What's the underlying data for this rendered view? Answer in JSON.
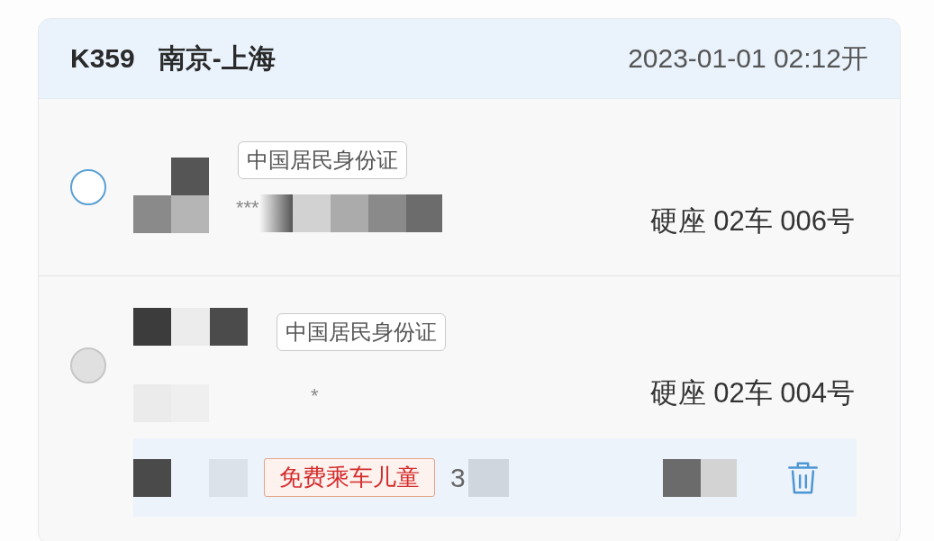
{
  "train": {
    "number": "K359",
    "route": "南京-上海",
    "departure": "2023-01-01 02:12开"
  },
  "passengers": [
    {
      "selected": false,
      "disabled": false,
      "id_type": "中国居民身份证",
      "id_fragment": "***",
      "seat": "硬座 02车 006号"
    },
    {
      "selected": false,
      "disabled": true,
      "id_type": "中国居民身份证",
      "id_fragment": "*",
      "seat": "硬座 02车 004号",
      "companions": [
        {
          "tag": "免费乘车儿童",
          "id_fragment": "3"
        }
      ]
    }
  ]
}
